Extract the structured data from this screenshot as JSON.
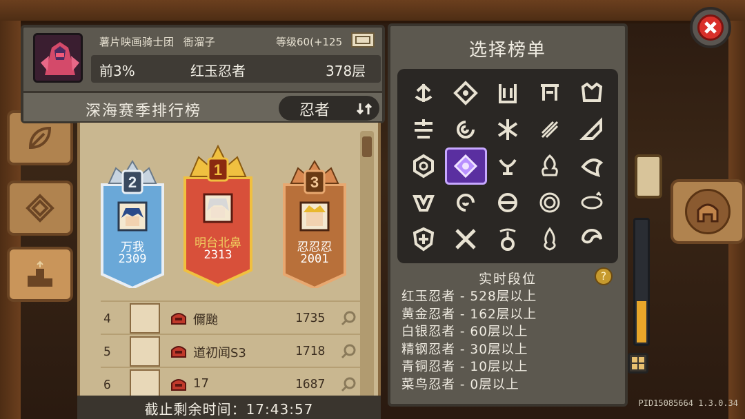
{
  "player": {
    "guild_name": "薯片映画骑士团",
    "name": "衙溜子",
    "level": "等级60(+125",
    "rank_percent": "前3%",
    "tier": "红玉忍者",
    "floor": "378层"
  },
  "leaderboard": {
    "title": "深海赛季排行榜",
    "class_filter": "忍者",
    "podium": [
      {
        "rank": "2",
        "name": "万我",
        "score": "2309"
      },
      {
        "rank": "1",
        "name": "明台北鼻",
        "score": "2313"
      },
      {
        "rank": "3",
        "name": "忍忍忍",
        "score": "2001"
      }
    ],
    "rows": [
      {
        "rank": "4",
        "name": "儞颱",
        "score": "1735"
      },
      {
        "rank": "5",
        "name": "道初闻S3",
        "score": "1718"
      },
      {
        "rank": "6",
        "name": "17",
        "score": "1687"
      }
    ],
    "deadline": "截止剩余时间：17:43:57"
  },
  "select_panel": {
    "title": "选择榜单",
    "selected_index": 11,
    "tier_title": "实时段位",
    "help_label": "?",
    "tiers": [
      "红玉忍者 - 528层以上",
      "黄金忍者 - 162层以上",
      "白银忍者 - 60层以上",
      "精钢忍者 - 30层以上",
      "青铜忍者 - 10层以上",
      "菜鸟忍者 - 0层以上"
    ]
  },
  "version": "PID15085664 1.3.0.34",
  "colors": {
    "gold": "#e8a62a",
    "selected": "#5a2fa0",
    "close": "#d9302a"
  }
}
